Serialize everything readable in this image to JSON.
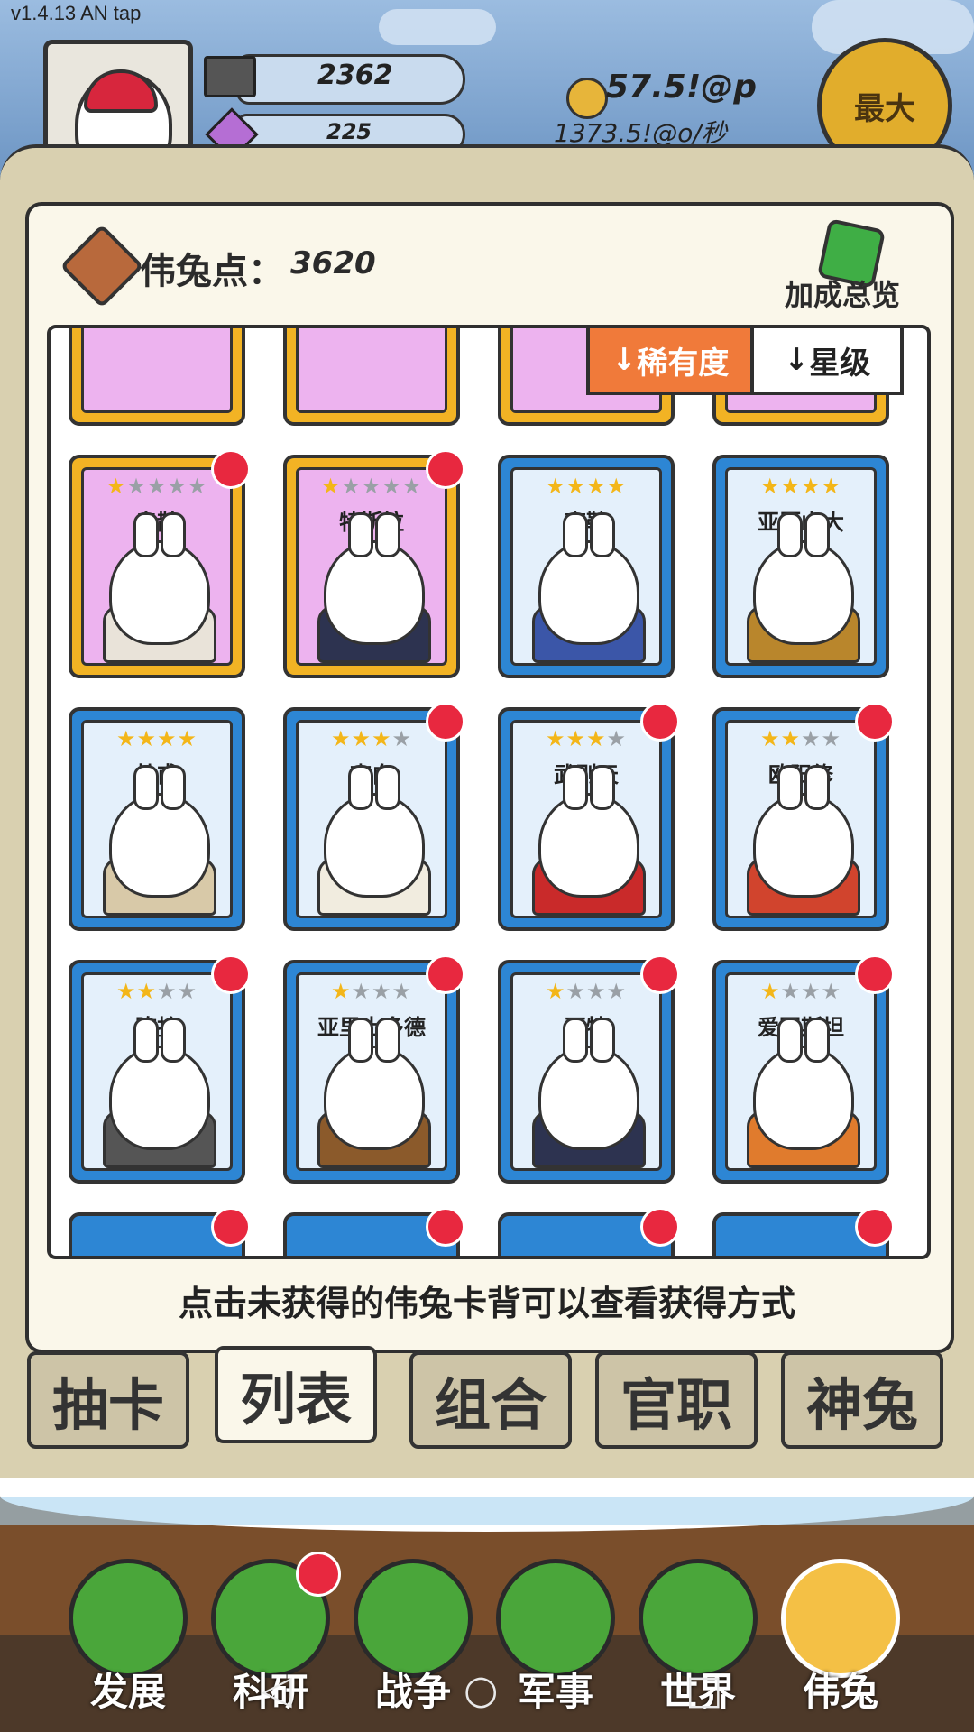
{
  "version": "v1.4.13 AN tap",
  "resources": {
    "stone": "2362",
    "crystal": "225"
  },
  "gold": {
    "amount": "57.5!@p",
    "rate": "1373.5!@o/秒"
  },
  "max_button": "最大",
  "points": {
    "label": "伟兔点：",
    "value": "3620"
  },
  "bonus_overview": "加成总览",
  "sort": {
    "rarity": "稀有度",
    "star": "星级"
  },
  "cards": [
    {
      "name": "扁鹊",
      "stars": 1,
      "frame": "gold",
      "robe": "#e9e3d9",
      "new": true
    },
    {
      "name": "特斯拉",
      "stars": 1,
      "frame": "gold",
      "robe": "#2d3350",
      "new": true
    },
    {
      "name": "商鞅",
      "stars": 4,
      "frame": "blue",
      "robe": "#3b56a8",
      "new": false
    },
    {
      "name": "亚历山大",
      "stars": 4,
      "frame": "blue",
      "robe": "#b9862c",
      "new": false
    },
    {
      "name": "杜甫",
      "stars": 4,
      "frame": "blue",
      "robe": "#d8c9a8",
      "new": false
    },
    {
      "name": "李白",
      "stars": 3,
      "frame": "blue",
      "robe": "#f1ecdf",
      "new": true
    },
    {
      "name": "武则天",
      "stars": 3,
      "frame": "blue",
      "robe": "#c92a2a",
      "new": true
    },
    {
      "name": "欧阳修",
      "stars": 2,
      "frame": "blue",
      "robe": "#d1442d",
      "new": true
    },
    {
      "name": "陈拾",
      "stars": 2,
      "frame": "blue",
      "robe": "#555555",
      "new": true
    },
    {
      "name": "亚里士多德",
      "stars": 1,
      "frame": "blue",
      "robe": "#8b5a2b",
      "new": true
    },
    {
      "name": "瓦特",
      "stars": 1,
      "frame": "blue",
      "robe": "#2d3350",
      "new": true
    },
    {
      "name": "爱因斯坦",
      "stars": 1,
      "frame": "blue",
      "robe": "#e07b2d",
      "new": true
    }
  ],
  "hint": "点击未获得的伟兔卡背可以查看获得方式",
  "tabs": [
    "抽卡",
    "列表",
    "组合",
    "官职",
    "神兔"
  ],
  "active_tab": 1,
  "nav": [
    "发展",
    "科研",
    "战争",
    "军事",
    "世界",
    "伟兔"
  ],
  "active_nav": 5
}
